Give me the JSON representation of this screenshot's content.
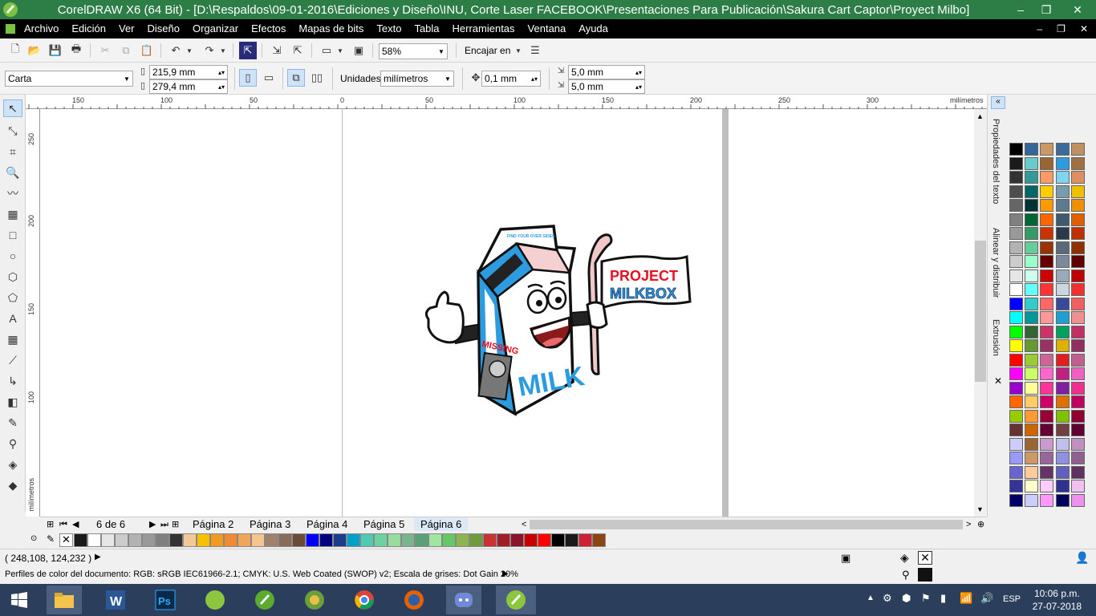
{
  "window": {
    "title": "CorelDRAW X6 (64 Bit) - [D:\\Respaldos\\09-01-2016\\Ediciones y Diseño\\INU, Corte Laser FACEBOOK\\Presentaciones Para Publicación\\Sakura Cart Captor\\Proyect Milbo]",
    "minimize": "–",
    "restore": "❐",
    "close": "✕"
  },
  "menu": {
    "items": [
      "Archivo",
      "Edición",
      "Ver",
      "Diseño",
      "Organizar",
      "Efectos",
      "Mapas de bits",
      "Texto",
      "Tabla",
      "Herramientas",
      "Ventana",
      "Ayuda"
    ],
    "doc_controls": [
      "–",
      "❐",
      "✕"
    ]
  },
  "toolbar": {
    "zoom": "58%",
    "snap_label": "Encajar en"
  },
  "propertybar": {
    "page_size": "Carta",
    "width": "215,9 mm",
    "height": "279,4 mm",
    "units_label": "Unidades:",
    "units_value": "milímetros",
    "nudge": "0,1 mm",
    "dup_x": "5,0 mm",
    "dup_y": "5,0 mm"
  },
  "ruler": {
    "h_ticks": [
      "150",
      "100",
      "50",
      "0",
      "50",
      "100",
      "150",
      "200",
      "250",
      "300"
    ],
    "h_unit": "milímetros",
    "v_ticks": [
      "250",
      "200",
      "150",
      "100"
    ],
    "v_unit": "milímetros"
  },
  "artwork": {
    "carton_top_text": "FIND YOUR OVER SIDES",
    "missing": "MISSING",
    "milk": "MILK",
    "flag_line1": "PROJECT",
    "flag_line2": "MILKBOX"
  },
  "pages": {
    "counter": "6 de 6",
    "tabs": [
      "Página 2",
      "Página 3",
      "Página 4",
      "Página 5",
      "Página 6"
    ],
    "active_tab": "Página 6"
  },
  "palette_bottom": [
    "#ffffff",
    "#000000",
    "#1a1a1a",
    "#ffffff",
    "#e6e6e6",
    "#cccccc",
    "#b3b3b3",
    "#999999",
    "#808080",
    "#333333",
    "#f5c89a",
    "#f7c000",
    "#f29a1f",
    "#f08a34",
    "#f0a65a",
    "#f6c48f",
    "#a0826c",
    "#8a6a5a",
    "#6b4a3a",
    "#0000ff",
    "#000080",
    "#1e3c8c",
    "#00a0c8",
    "#50c8b4",
    "#6ed2a0",
    "#98dca0",
    "#78b48c",
    "#5aa078",
    "#a0e6a0",
    "#64c864",
    "#8cb450",
    "#6e9b3c",
    "#c83232",
    "#a01e28",
    "#8c1428",
    "#c80000",
    "#ff0000",
    "#000000",
    "#1a1a1a",
    "#cc2233",
    "#8b4513"
  ],
  "status": {
    "coords": "( 248,108, 124,232 )",
    "color_profiles": "Perfiles de color del documento: RGB: sRGB IEC61966-2.1; CMYK: U.S. Web Coated (SWOP) v2; Escala de grises: Dot Gain 20%"
  },
  "dockers": {
    "tabs": [
      "Propiedades del texto",
      "Alinear y distribuir",
      "Extrusión"
    ]
  },
  "taskbar": {
    "time": "10:06 p.m.",
    "date": "27-07-2018",
    "lang": "ESP"
  }
}
